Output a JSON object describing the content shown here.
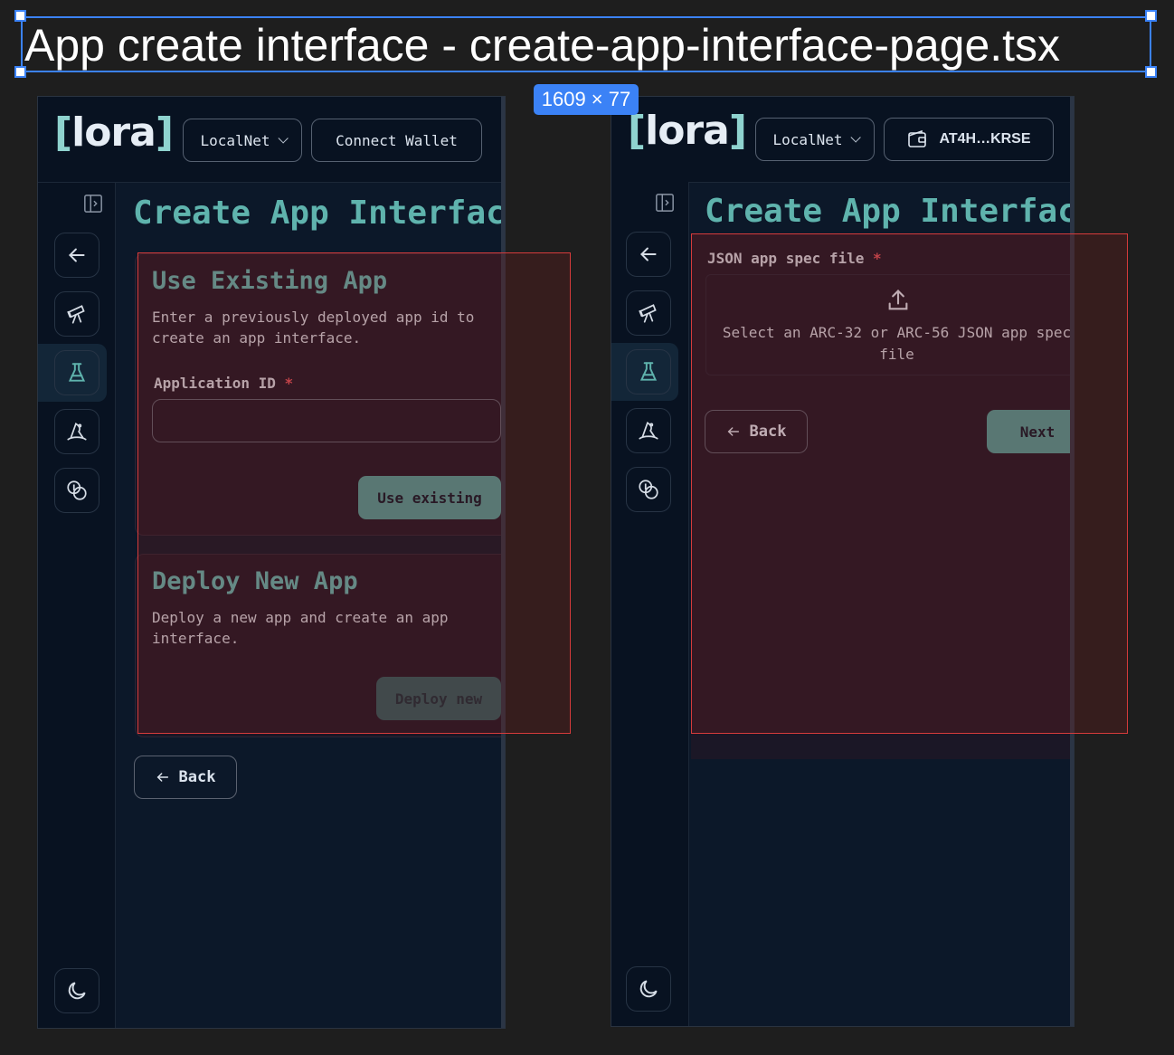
{
  "frame": {
    "title": "App create interface - create-app-interface-page.tsx",
    "size_badge": "1609 × 77"
  },
  "left_panel": {
    "logo": "[lora]",
    "network_label": "LocalNet",
    "connect_wallet_label": "Connect Wallet",
    "page_title": "Create App Interface",
    "use_existing": {
      "title": "Use Existing App",
      "description": "Enter a previously deployed app id to create an app interface.",
      "field_label": "Application ID",
      "required_mark": "*",
      "field_value": "",
      "button_label": "Use existing"
    },
    "deploy_new": {
      "title": "Deploy New App",
      "description": "Deploy a new app and create an app interface.",
      "button_label": "Deploy new"
    },
    "back_label": "Back"
  },
  "right_panel": {
    "logo": "[lora]",
    "network_label": "LocalNet",
    "wallet_address": "AT4H…KRSE",
    "page_title": "Create App Interface",
    "spec_field_label": "JSON app spec file",
    "required_mark": "*",
    "dropzone_text_line1": "Select an ARC-32 or ARC-56 JSON app spec",
    "dropzone_text_line2": "file",
    "back_label": "Back",
    "next_label": "Next"
  },
  "sidebar_icons": [
    "panel-toggle-icon",
    "back-arrow-icon",
    "telescope-icon",
    "flask-icon",
    "wizard-hat-icon",
    "coins-icon",
    "moon-icon"
  ],
  "colors": {
    "accent": "#5fb3ad",
    "button_teal": "#4e9a95",
    "background": "#0c1829",
    "card": "#1b1726",
    "required": "#e0525a",
    "selection": "#3b82f6",
    "overlay_border": "#d63b3b"
  }
}
